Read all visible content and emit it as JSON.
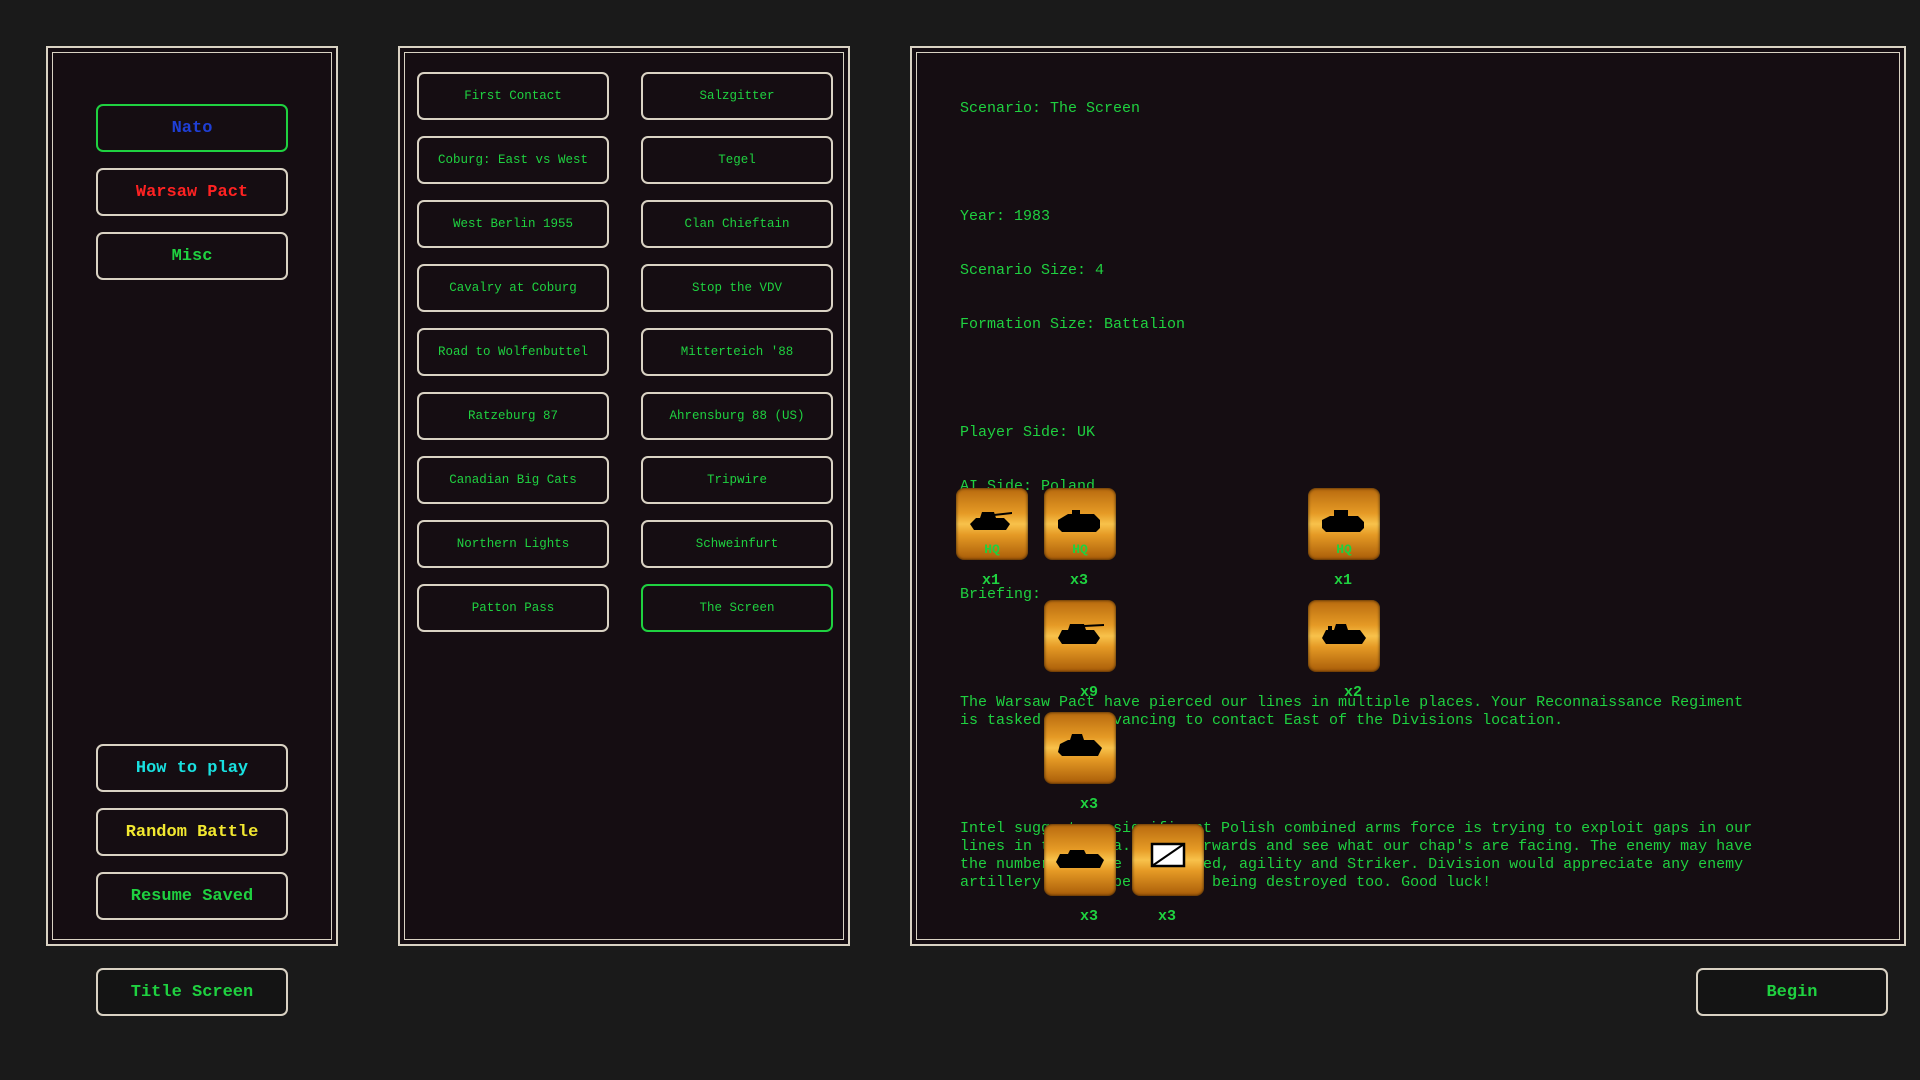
{
  "colors": {
    "nato": "#1f3fd6",
    "warsaw_pact": "#ff2222",
    "misc": "#1fd140",
    "how_to_play": "#19e0e0",
    "random_battle": "#f2e830",
    "resume_saved": "#1fd140",
    "text": "#1fd140",
    "counter_orange": "#f0a030"
  },
  "side_menu": {
    "nato": "Nato",
    "warsaw_pact": "Warsaw Pact",
    "misc": "Misc",
    "how_to_play": "How to play",
    "random_battle": "Random Battle",
    "resume_saved": "Resume Saved"
  },
  "scenarios": {
    "left": [
      "First Contact",
      "Coburg: East vs West",
      "West Berlin 1955",
      "Cavalry at Coburg",
      "Road to Wolfenbuttel",
      "Ratzeburg 87",
      "Canadian Big Cats",
      "Northern Lights",
      "Patton Pass"
    ],
    "right": [
      "Salzgitter",
      "Tegel",
      "Clan Chieftain",
      "Stop the VDV",
      "Mitterteich '88",
      "Ahrensburg 88 (US)",
      "Tripwire",
      "Schweinfurt",
      "The Screen"
    ],
    "selected": "The Screen"
  },
  "info": {
    "scenario": "Scenario: The Screen",
    "year": "Year: 1983",
    "scenario_size": "Scenario Size: 4",
    "formation_size": "Formation Size: Battalion",
    "player_side": "Player Side: UK",
    "ai_side": "AI Side: Poland",
    "briefing_label": "Briefing:",
    "briefing_p1": "The Warsaw Pact have pierced our lines in multiple places. Your Reconnaissance Regiment\nis tasked with advancing to contact East of the Divisions location.",
    "briefing_p2": "Intel suggests a significant Polish combined arms force is trying to exploit gaps in our\nlines in this area. Push forwards and see what our chap's are facing. The enemy may have\nthe numbers but we have speed, agility and Striker. Division would appreciate any enemy\nartillery you happen across being destroyed too. Good luck!"
  },
  "units": [
    {
      "icon": "tank-icon",
      "hq": "HQ",
      "count": "x1"
    },
    {
      "icon": "apc-icon",
      "hq": "HQ",
      "count": "x3"
    },
    {
      "icon": "light-tank-icon",
      "hq": "",
      "count": "x9"
    },
    {
      "icon": "tracked-vehicle-icon",
      "hq": "",
      "count": "x3"
    },
    {
      "icon": "armored-car-icon",
      "hq": "",
      "count": "x3"
    },
    {
      "icon": "infantry-symbol-icon",
      "hq": "",
      "count": "x3"
    },
    {
      "icon": "apc-icon",
      "hq": "HQ",
      "count": "x1"
    },
    {
      "icon": "recon-vehicle-icon",
      "hq": "",
      "count": "x2"
    }
  ],
  "bottom": {
    "title_screen": "Title Screen",
    "begin": "Begin"
  }
}
